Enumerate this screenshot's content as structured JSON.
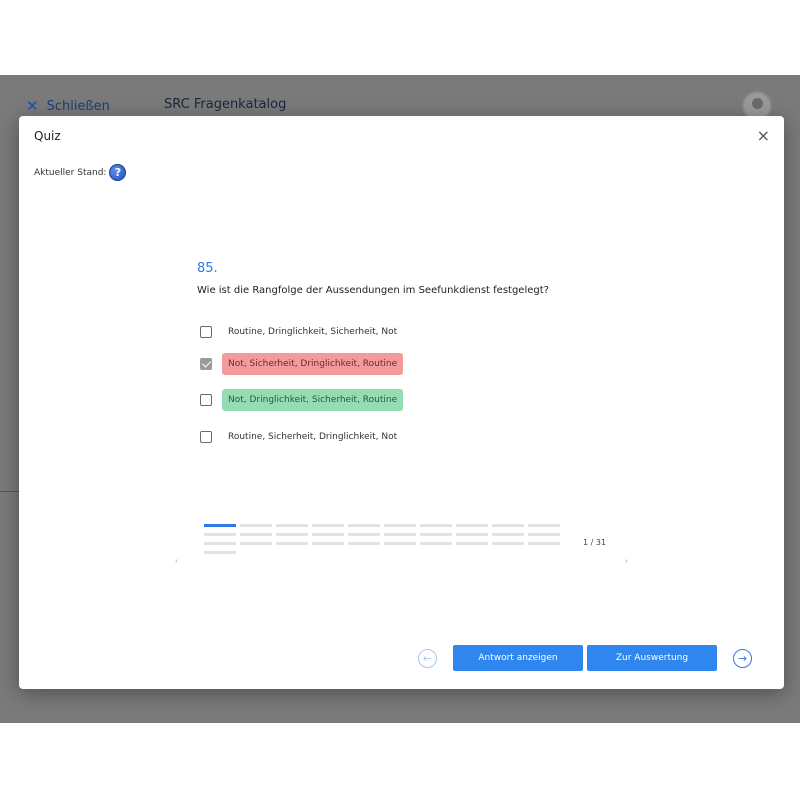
{
  "background": {
    "close_label": "Schließen",
    "close_icon": "close-icon",
    "app_title": "SRC Fragenkatalog"
  },
  "modal": {
    "title": "Quiz",
    "close_icon": "×",
    "status_label": "Aktueller Stand:",
    "help_icon": "?"
  },
  "question": {
    "number": "85.",
    "text": "Wie ist die Rangfolge der Aussendungen im Seefunkdienst festgelegt?",
    "options": [
      {
        "label": "Routine, Dringlichkeit, Sicherheit, Not",
        "checked": false,
        "state": "neutral"
      },
      {
        "label": "Not, Sicherheit, Dringlichkeit, Routine",
        "checked": true,
        "state": "wrong"
      },
      {
        "label": "Not, Dringlichkeit, Sicherheit, Routine",
        "checked": false,
        "state": "correct"
      },
      {
        "label": "Routine, Sicherheit, Dringlichkeit, Not",
        "checked": false,
        "state": "neutral"
      }
    ]
  },
  "progress": {
    "page_indicator": "1 / 31",
    "prev_glyph": "‹",
    "next_glyph": "›"
  },
  "footer": {
    "prev_icon": "←",
    "show_answer_label": "Antwort anzeigen",
    "evaluate_label": "Zur Auswertung",
    "next_icon": "→"
  },
  "colors": {
    "accent": "#2f86ee",
    "wrong": "#f59a9a",
    "correct": "#95dcb2"
  }
}
